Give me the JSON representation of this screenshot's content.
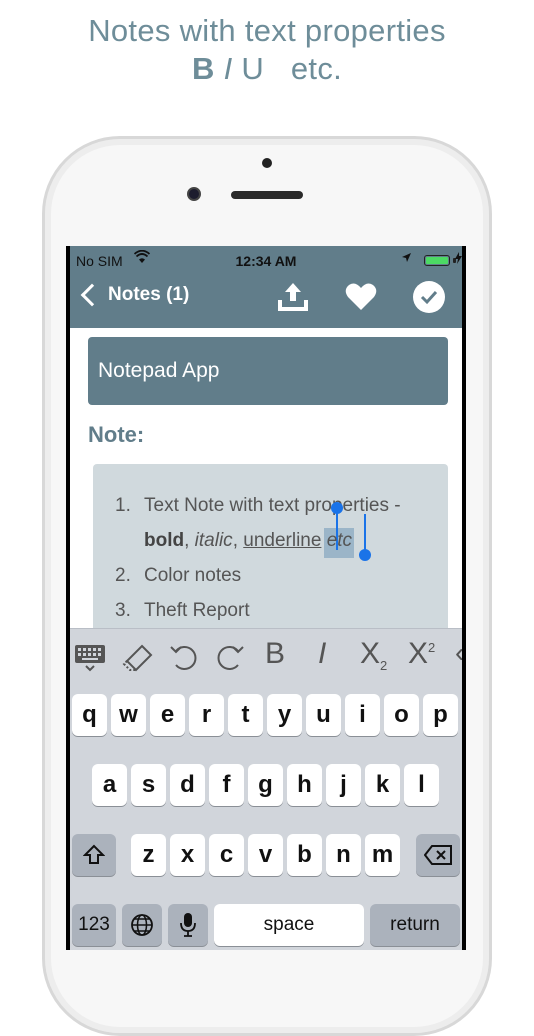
{
  "caption": {
    "line1": "Notes with text properties",
    "bold": "B",
    "italic": "I",
    "underline": "U",
    "etc": "etc."
  },
  "status_bar": {
    "carrier": "No SIM",
    "time": "12:34 AM"
  },
  "nav": {
    "back_label": "Notes (1)",
    "icons": [
      "share-icon",
      "heart-icon",
      "check-icon"
    ]
  },
  "note": {
    "title": "Notepad App",
    "label": "Note:",
    "items": [
      {
        "num": "1.",
        "text": "Text Note with text properties -"
      },
      {
        "num": "",
        "bold": "bold",
        "sep1": ", ",
        "italic": "italic",
        "sep2": ", ",
        "underline": "underline",
        "selected": "etc"
      },
      {
        "num": "2.",
        "text": "Color notes"
      },
      {
        "num": "3.",
        "text": "Theft Report"
      }
    ]
  },
  "toolbar": {
    "bold": "B",
    "italic": "I",
    "subscript": "X",
    "sub_mark": "2",
    "superscript": "X",
    "sup_mark": "2"
  },
  "keyboard": {
    "row1": [
      "q",
      "w",
      "e",
      "r",
      "t",
      "y",
      "u",
      "i",
      "o",
      "p"
    ],
    "row2": [
      "a",
      "s",
      "d",
      "f",
      "g",
      "h",
      "j",
      "k",
      "l"
    ],
    "row3": [
      "z",
      "x",
      "c",
      "v",
      "b",
      "n",
      "m"
    ],
    "numbers_key": "123",
    "space_key": "space",
    "return_key": "return"
  },
  "colors": {
    "accent": "#617d8a",
    "caption": "#6e8d99",
    "note_bg": "#d0d9dd",
    "selection": "#1a73e8"
  }
}
